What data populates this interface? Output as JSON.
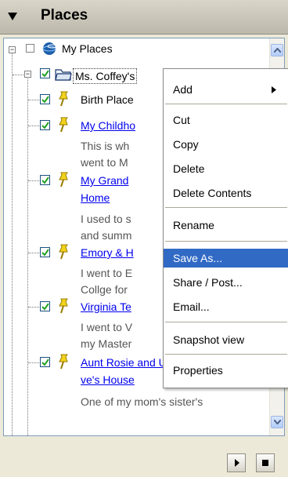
{
  "panel": {
    "title": "Places"
  },
  "tree": {
    "root": {
      "label": "My Places"
    },
    "folder": {
      "label": "Ms. Coffey's"
    },
    "items": [
      {
        "label": "Birth Place",
        "link": false,
        "desc": []
      },
      {
        "label": "My Childho",
        "link": true,
        "desc": [
          "This is wh",
          "went to M"
        ]
      },
      {
        "label": "My Grand",
        "label2": "Home",
        "link": true,
        "desc": [
          "I used to s",
          "and summ"
        ]
      },
      {
        "label": "Emory & H",
        "link": true,
        "desc": [
          "I went to E",
          "Collge for"
        ]
      },
      {
        "label": "Virginia Te",
        "link": true,
        "desc": [
          "I went to V",
          "my Master"
        ]
      },
      {
        "label": "Aunt Rosie and Uncle Da",
        "label2": "ve's House",
        "link": true,
        "desc": [
          "One of my mom's sister's"
        ]
      }
    ]
  },
  "context_menu": {
    "items": [
      {
        "label": "Add",
        "submenu": true
      },
      {
        "label": "Cut"
      },
      {
        "label": "Copy"
      },
      {
        "label": "Delete"
      },
      {
        "label": "Delete Contents"
      },
      {
        "label": "Rename"
      },
      {
        "label": "Save As...",
        "selected": true
      },
      {
        "label": "Share / Post..."
      },
      {
        "label": "Email..."
      },
      {
        "label": "Snapshot view"
      },
      {
        "label": "Properties"
      }
    ]
  },
  "colors": {
    "selection": "#316ac5",
    "link": "#0000ee",
    "pin": "#f2d21c"
  }
}
